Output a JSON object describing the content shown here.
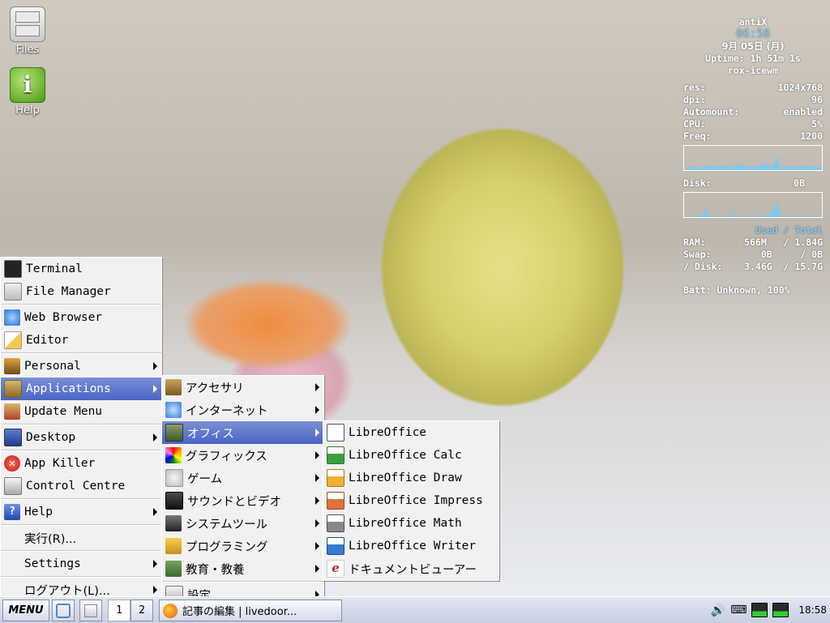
{
  "desktop": {
    "icons": [
      {
        "label": "Files",
        "icon": "file-cabinet-icon"
      },
      {
        "label": "Help",
        "icon": "info-icon"
      }
    ]
  },
  "conky": {
    "hostname": "antiX",
    "clock": "06:58",
    "date": "9月 05日 (月)",
    "uptime": "Uptime: 1h 51m 1s",
    "wm": "rox-icewm",
    "res_label": "res:",
    "res_value": "1024x768",
    "dpi_label": "dpi:",
    "dpi_value": "96",
    "automount_label": "Automount:",
    "automount_value": "enabled",
    "cpu_label": "CPU:",
    "cpu_value": "5%",
    "freq_label": "Freq:",
    "freq_value": "1200",
    "disk_label": "Disk:",
    "disk_value": "0B",
    "used_total_header": "Used / Total",
    "ram_label": "RAM:",
    "ram_value": "566M   / 1.84G",
    "swap_label": "Swap:",
    "swap_value": "0B     / 0B",
    "rootdisk_label": "/ Disk:",
    "rootdisk_value": "3.46G  / 15.7G",
    "batt": "Batt: Unknown, 100%"
  },
  "main_menu": {
    "items": [
      {
        "label": "Terminal",
        "icon": "terminal-icon",
        "submenu": false
      },
      {
        "label": "File Manager",
        "icon": "file-manager-icon",
        "submenu": false
      },
      {
        "label": "Web Browser",
        "icon": "browser-icon",
        "submenu": false
      },
      {
        "label": "Editor",
        "icon": "editor-icon",
        "submenu": false
      },
      {
        "label": "Personal",
        "icon": "personal-icon",
        "submenu": true
      },
      {
        "label": "Applications",
        "icon": "applications-icon",
        "submenu": true,
        "selected": true
      },
      {
        "label": "Update Menu",
        "icon": "update-icon",
        "submenu": false
      },
      {
        "label": "Desktop",
        "icon": "desktop-icon",
        "submenu": true
      },
      {
        "label": "App Killer",
        "icon": "app-killer-icon",
        "submenu": false
      },
      {
        "label": "Control Centre",
        "icon": "control-centre-icon",
        "submenu": false
      },
      {
        "label": "Help",
        "icon": "help-icon",
        "submenu": true
      },
      {
        "label": "実行(R)...",
        "icon": "",
        "submenu": false
      },
      {
        "label": "Settings",
        "icon": "",
        "submenu": true
      },
      {
        "label": "ログアウト(L)...",
        "icon": "",
        "submenu": true
      }
    ]
  },
  "apps_menu": {
    "items": [
      {
        "label": "アクセサリ",
        "icon": "accessories-icon"
      },
      {
        "label": "インターネット",
        "icon": "internet-icon"
      },
      {
        "label": "オフィス",
        "icon": "office-icon",
        "selected": true
      },
      {
        "label": "グラフィックス",
        "icon": "graphics-icon"
      },
      {
        "label": "ゲーム",
        "icon": "games-icon"
      },
      {
        "label": "サウンドとビデオ",
        "icon": "sound-video-icon"
      },
      {
        "label": "システムツール",
        "icon": "system-tools-icon"
      },
      {
        "label": "プログラミング",
        "icon": "programming-icon"
      },
      {
        "label": "教育・教養",
        "icon": "education-icon"
      },
      {
        "label": "設定",
        "icon": "settings-icon"
      }
    ]
  },
  "office_menu": {
    "items": [
      {
        "label": "LibreOffice",
        "icon": "libreoffice-icon"
      },
      {
        "label": "LibreOffice Calc",
        "icon": "libreoffice-calc-icon"
      },
      {
        "label": "LibreOffice Draw",
        "icon": "libreoffice-draw-icon"
      },
      {
        "label": "LibreOffice Impress",
        "icon": "libreoffice-impress-icon"
      },
      {
        "label": "LibreOffice Math",
        "icon": "libreoffice-math-icon"
      },
      {
        "label": "LibreOffice Writer",
        "icon": "libreoffice-writer-icon"
      },
      {
        "label": "ドキュメントビューアー",
        "icon": "document-viewer-icon"
      }
    ]
  },
  "taskbar": {
    "menu_label": "MENU",
    "workspaces": [
      "1",
      "2"
    ],
    "window_title": "記事の編集 | livedoor...",
    "clock": "18:58"
  },
  "colors": {
    "selection": "#4a64c4",
    "menu_bg": "#f1f1f1",
    "conky_accent": "#7fc8f0"
  }
}
